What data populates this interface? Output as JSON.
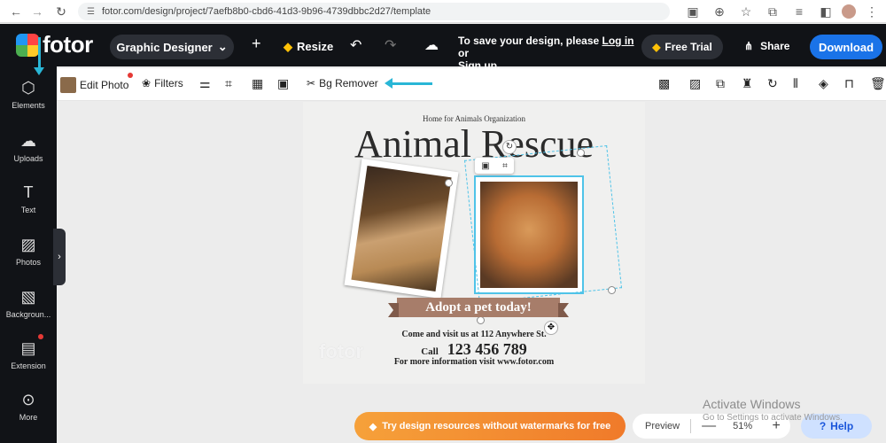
{
  "browser": {
    "url": "fotor.com/design/project/7aefb8b0-cbd6-41d3-9b96-4739dbbc2d27/template"
  },
  "topbar": {
    "logo": "fotor",
    "designer_label": "Graphic Designer",
    "resize_label": "Resize",
    "save_msg_prefix": "To save your design, please",
    "login_label": "Log in",
    "save_msg_or": "or",
    "signup_label": "Sign up",
    "save_msg_suffix": ".",
    "free_trial_label": "Free Trial",
    "share_label": "Share",
    "download_label": "Download"
  },
  "sidebar": {
    "items": [
      {
        "label": "Elements"
      },
      {
        "label": "Uploads"
      },
      {
        "label": "Text"
      },
      {
        "label": "Photos"
      },
      {
        "label": "Backgroun..."
      },
      {
        "label": "Extension"
      },
      {
        "label": "More"
      }
    ]
  },
  "toolbar": {
    "edit_photo_label": "Edit Photo",
    "filters_label": "Filters",
    "bg_remover_label": "Bg Remover"
  },
  "design": {
    "org": "Home for Animals Organization",
    "headline": "Animal Rescue",
    "ribbon": "Adopt a pet today!",
    "visit": "Come and visit us at 112 Anywhere St.",
    "call_label": "Call",
    "phone": "123 456 789",
    "more_info": "For more information visit www.fotor.com",
    "watermark": "fotor"
  },
  "bottom": {
    "promo_label": "Try design resources without watermarks for free",
    "preview_label": "Preview",
    "zoom_minus": "—",
    "zoom_value": "51%",
    "zoom_plus": "+",
    "help_label": "Help"
  },
  "os_overlay": {
    "title": "Activate Windows",
    "subtitle": "Go to Settings to activate Windows."
  },
  "colors": {
    "accent": "#1a73e8",
    "annotation_arrow": "#29b6d6",
    "promo": "#f6a13a",
    "ribbon": "#a77d6a"
  }
}
